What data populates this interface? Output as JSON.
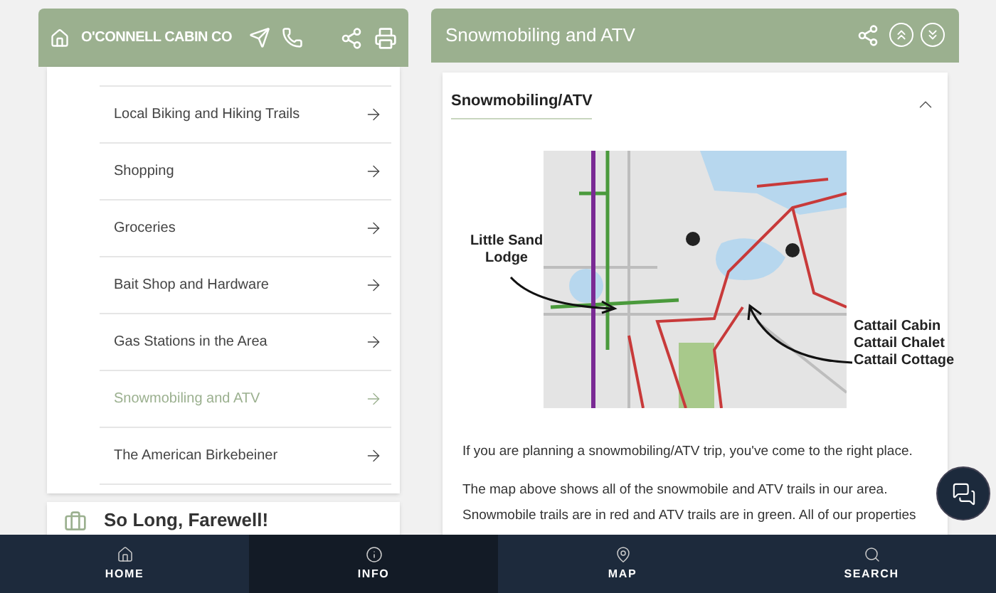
{
  "header": {
    "brand": "O'CONNELL CABIN CO"
  },
  "menu": {
    "items": [
      {
        "label": "Local Biking and Hiking Trails",
        "selected": false
      },
      {
        "label": "Shopping",
        "selected": false
      },
      {
        "label": "Groceries",
        "selected": false
      },
      {
        "label": "Bait Shop and Hardware",
        "selected": false
      },
      {
        "label": "Gas Stations in the Area",
        "selected": false
      },
      {
        "label": "Snowmobiling and ATV",
        "selected": true
      },
      {
        "label": "The American Birkebeiner",
        "selected": false
      }
    ]
  },
  "next_section": {
    "title": "So Long, Farewell!"
  },
  "detail": {
    "title": "Snowmobiling and ATV",
    "section": {
      "title": "Snowmobiling/ATV",
      "expanded": true
    },
    "map": {
      "kind": "picture",
      "left_label": "Little Sand Lodge",
      "right_labels": [
        "Cattail Cabin",
        "Cattail Chalet",
        "Cattail Cottage"
      ]
    },
    "paragraphs": [
      "If you are planning a snowmobiling/ATV trip, you've come to the right place.",
      "The map above shows all of the snowmobile and ATV trails in our area.  Snowmobile trails are in red and ATV trails are in green.  All of our properties"
    ]
  },
  "nav": [
    {
      "label": "HOME",
      "selected": false
    },
    {
      "label": "INFO",
      "selected": true
    },
    {
      "label": "MAP",
      "selected": false
    },
    {
      "label": "SEARCH",
      "selected": false
    }
  ]
}
